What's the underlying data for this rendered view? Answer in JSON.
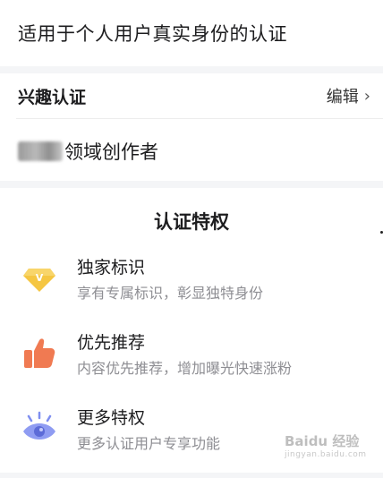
{
  "top": {
    "text": "适用于个人用户真实身份的认证"
  },
  "interest": {
    "title": "兴趣认证",
    "edit_label": "编辑",
    "creator_text": "领域创作者"
  },
  "privileges": {
    "title": "认证特权",
    "items": [
      {
        "name": "独家标识",
        "desc": "享有专属标识，彰显独特身份",
        "icon": "diamond-icon",
        "color": "#f5c642"
      },
      {
        "name": "优先推荐",
        "desc": "内容优先推荐，增加曝光快速涨粉",
        "icon": "thumbs-up-icon",
        "color": "#f07a52"
      },
      {
        "name": "更多特权",
        "desc": "更多认证用户专享功能",
        "icon": "eye-icon",
        "color": "#7f8ff0"
      }
    ]
  },
  "watermark": {
    "logo": "Baidu 经验",
    "sub": "jingyan.baidu.com"
  }
}
